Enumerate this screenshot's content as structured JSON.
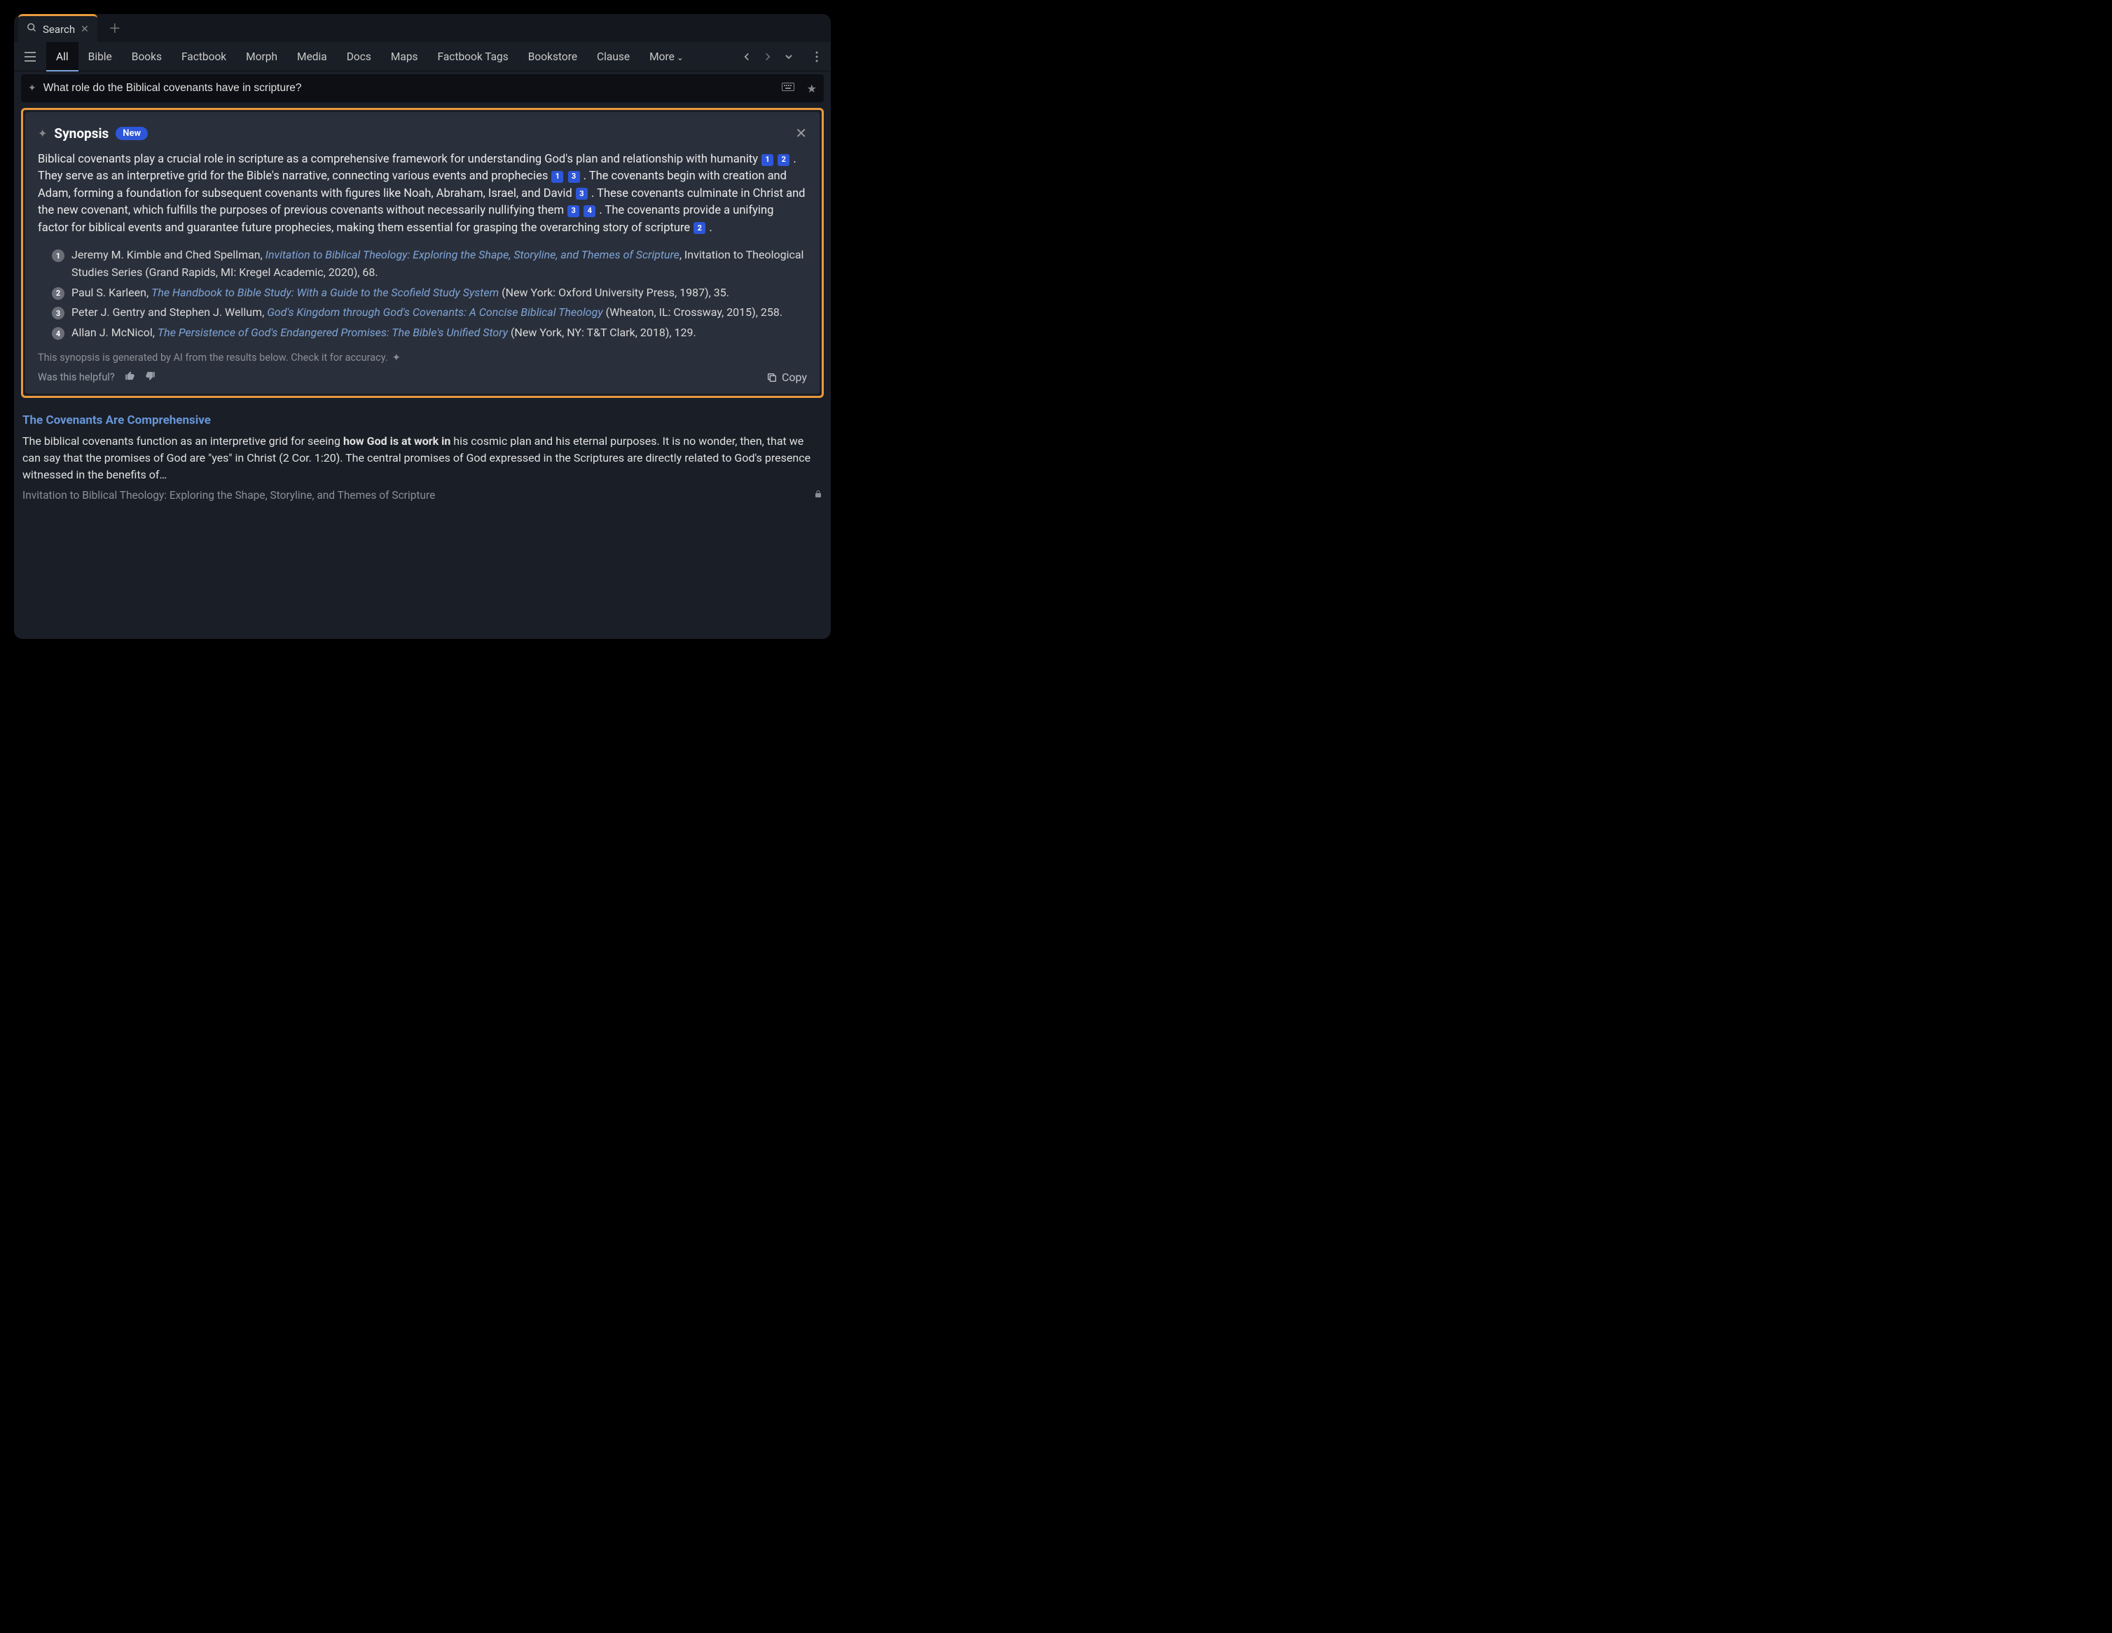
{
  "tab": {
    "title": "Search"
  },
  "navtabs": [
    "All",
    "Bible",
    "Books",
    "Factbook",
    "Morph",
    "Media",
    "Docs",
    "Maps",
    "Factbook Tags",
    "Bookstore",
    "Clause",
    "More"
  ],
  "active_navtab": 0,
  "search": {
    "query": "What role do the Biblical covenants have in scripture?"
  },
  "synopsis": {
    "heading": "Synopsis",
    "badge": "New",
    "segments": [
      {
        "text": "Biblical covenants play a crucial role in scripture as a comprehensive framework for understanding God's plan and relationship with humanity "
      },
      {
        "cite": "1"
      },
      {
        "text": " "
      },
      {
        "cite": "2"
      },
      {
        "text": " . They serve as an interpretive grid for the Bible's narrative, connecting various events and prophecies "
      },
      {
        "cite": "1"
      },
      {
        "text": " "
      },
      {
        "cite": "3"
      },
      {
        "text": " . The covenants begin with creation and Adam, forming a foundation for subsequent covenants with figures like Noah, Abraham, Israel, and David "
      },
      {
        "cite": "3"
      },
      {
        "text": " . These covenants culminate in Christ and the new covenant, which fulfills the purposes of previous covenants without necessarily nullifying them "
      },
      {
        "cite": "3"
      },
      {
        "text": " "
      },
      {
        "cite": "4"
      },
      {
        "text": " . The covenants provide a unifying factor for biblical events and guarantee future prophecies, making them essential for grasping the overarching story of scripture "
      },
      {
        "cite": "2"
      },
      {
        "text": " ."
      }
    ],
    "refs": [
      {
        "n": "1",
        "pre": "Jeremy M. Kimble and Ched Spellman, ",
        "title": "Invitation to Biblical Theology: Exploring the Shape, Storyline, and Themes of Scripture",
        "post": ", Invitation to Theological Studies Series (Grand Rapids, MI: Kregel Academic, 2020), 68."
      },
      {
        "n": "2",
        "pre": "Paul S. Karleen, ",
        "title": "The Handbook to Bible Study: With a Guide to the Scofield Study System",
        "post": " (New York: Oxford University Press, 1987), 35."
      },
      {
        "n": "3",
        "pre": "Peter J. Gentry and Stephen J. Wellum, ",
        "title": "God's Kingdom through God's Covenants: A Concise Biblical Theology",
        "post": " (Wheaton, IL: Crossway, 2015), 258."
      },
      {
        "n": "4",
        "pre": "Allan J. McNicol, ",
        "title": "The Persistence of God's Endangered Promises: The Bible's Unified Story",
        "post": " (New York, NY: T&T Clark, 2018), 129."
      }
    ],
    "disclaimer": "This synopsis is generated by AI from the results below. Check it for accuracy.",
    "helpful_label": "Was this helpful?",
    "copy_label": "Copy"
  },
  "result": {
    "title": "The Covenants Are Comprehensive",
    "pre": "The biblical covenants function as an interpretive grid for seeing ",
    "bold": "how God is at work in",
    "post": " his cosmic plan and his eternal purposes. It is no wonder, then, that we can say that the promises of God are \"yes\" in Christ (2 Cor. 1:20). The central promises of God expressed in the Scriptures are directly related to God's presence witnessed in the benefits of…",
    "source": "Invitation to Biblical Theology: Exploring the Shape, Storyline, and Themes of Scripture"
  }
}
